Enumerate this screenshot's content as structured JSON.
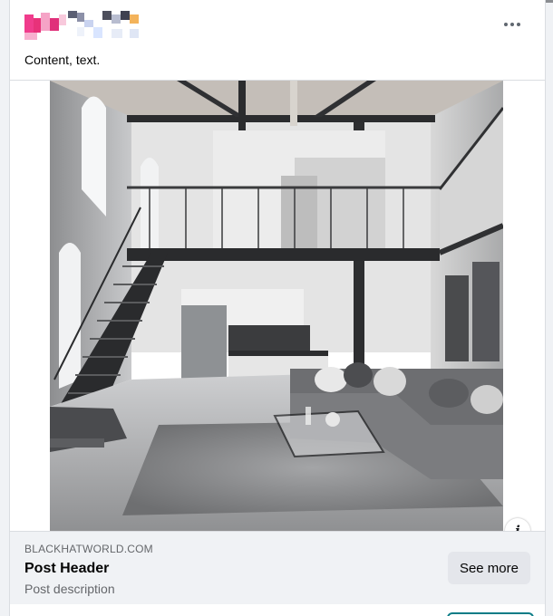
{
  "post": {
    "author_name": "",
    "text": "Content, text."
  },
  "link_preview": {
    "domain": "BLACKHATWORLD.COM",
    "headline": "Post Header",
    "description": "Post description",
    "cta_label": "See more"
  },
  "icons": {
    "more": "more-options-icon",
    "info": "info-icon"
  },
  "colors": {
    "card_bg": "#ffffff",
    "footer_bg": "#f0f2f5",
    "secondary_text": "#65676b",
    "primary_text": "#050505",
    "cta_bg": "#e4e6eb"
  }
}
